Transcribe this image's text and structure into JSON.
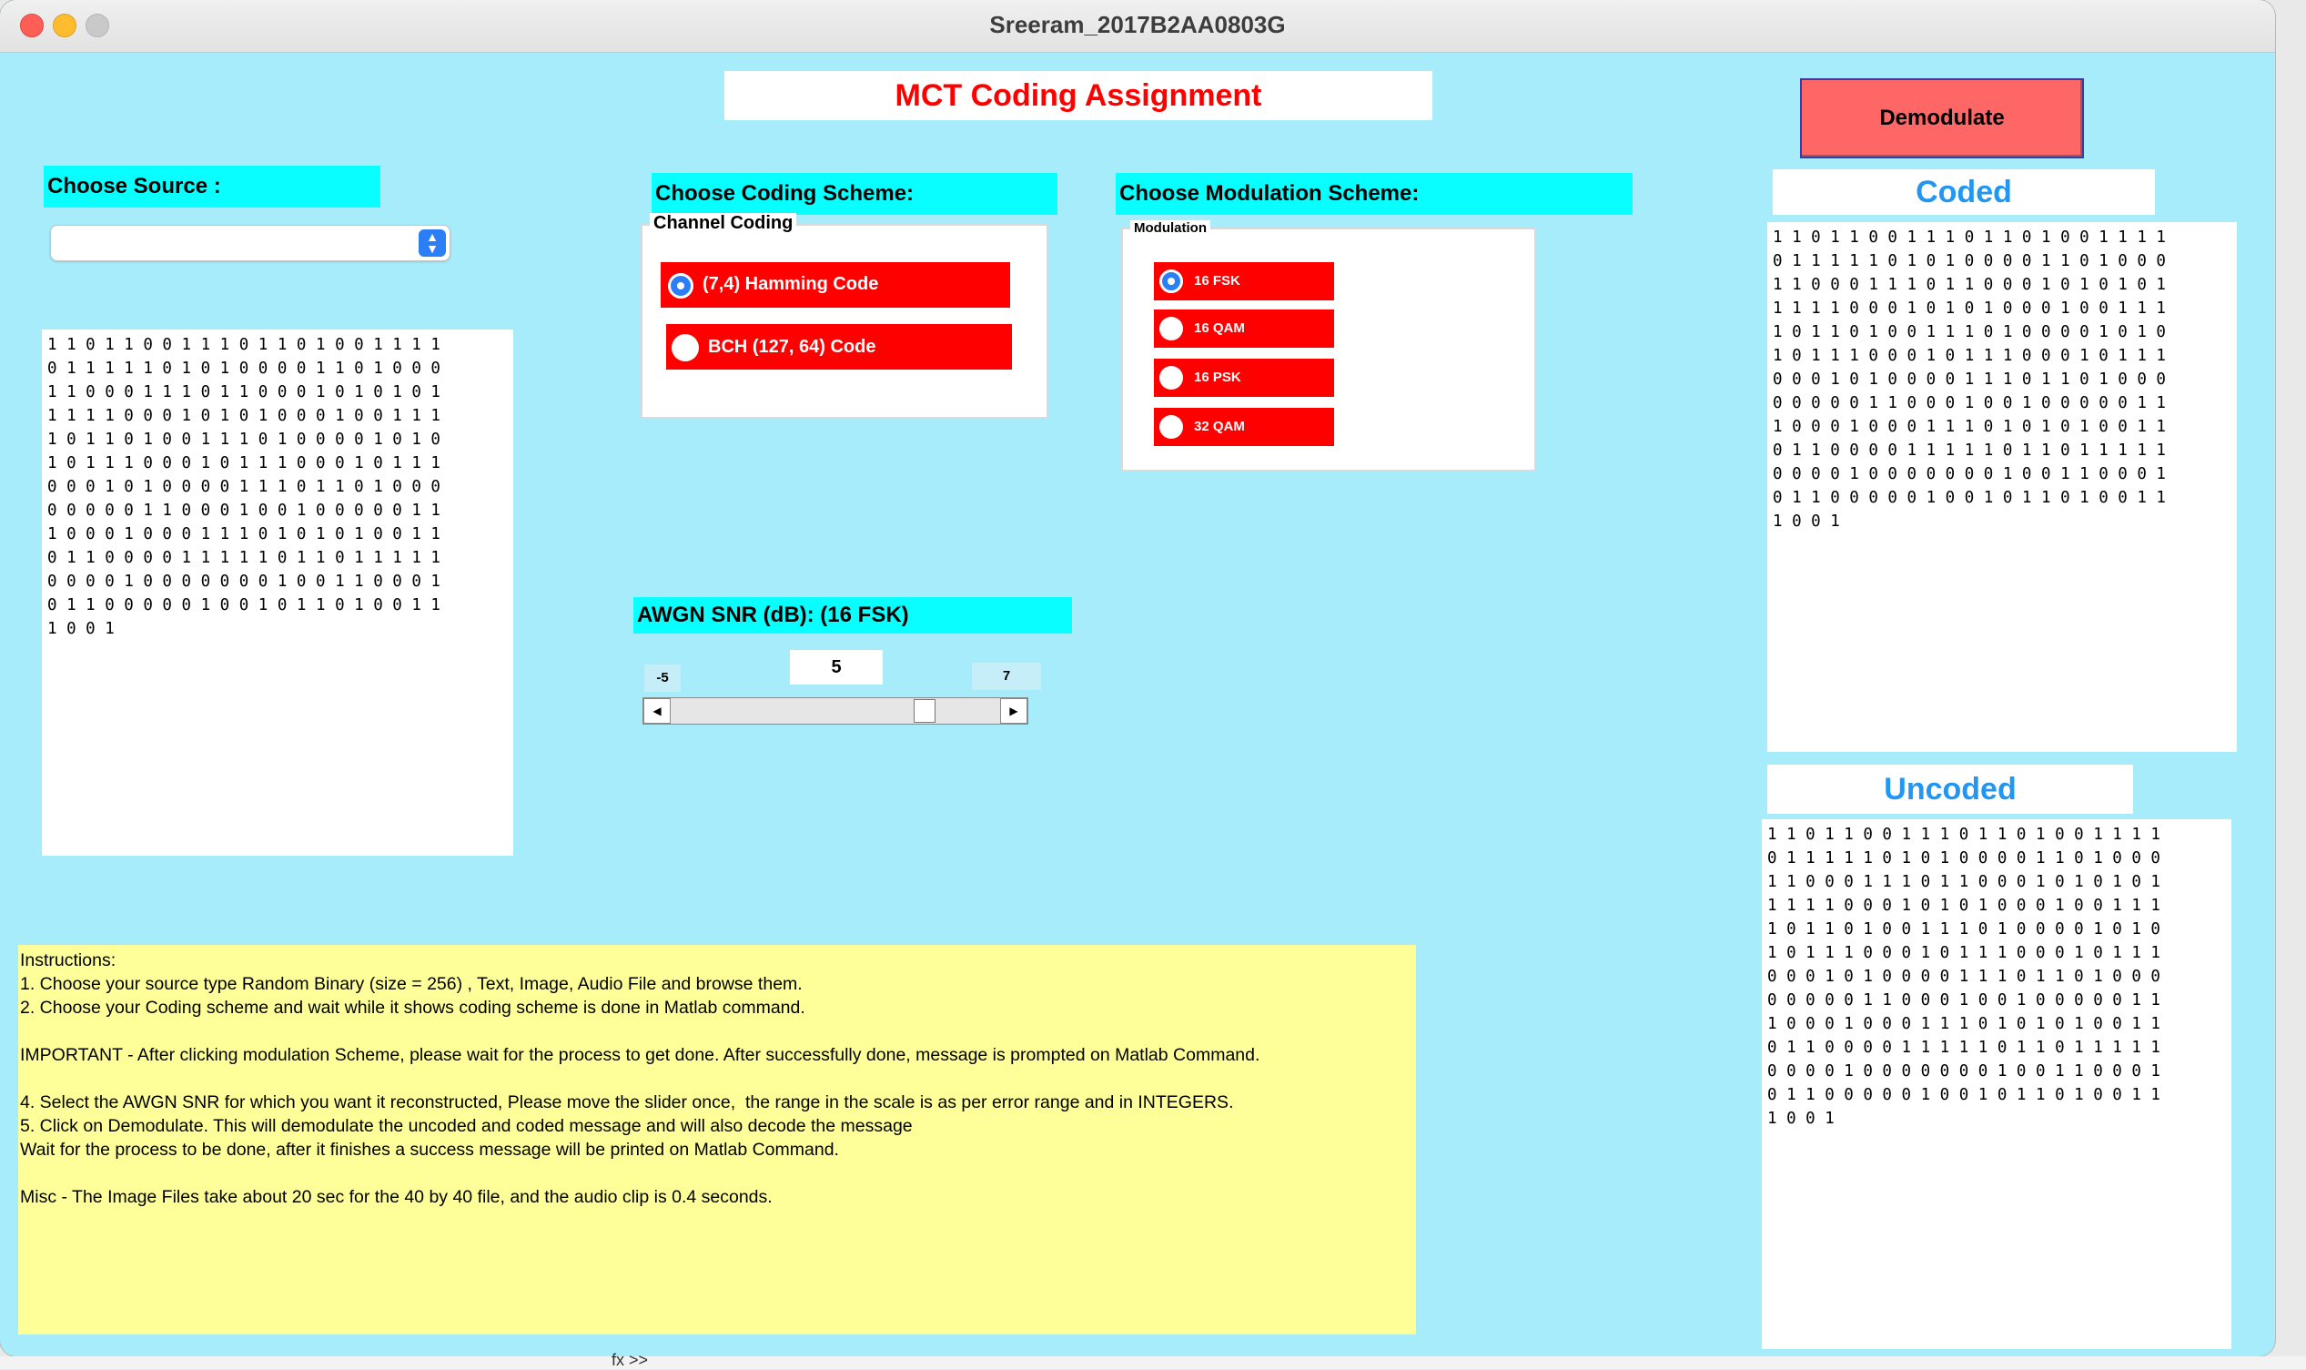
{
  "window": {
    "title": "Sreeram_2017B2AA0803G"
  },
  "header": {
    "title": "MCT Coding Assignment"
  },
  "source": {
    "label": "Choose Source :",
    "selected": "",
    "bits": [
      "1 1 0 1 1 0 0 1 1 1 0 1 1 0 1 0 0 1 1 1 1",
      "0 1 1 1 1 1 0 1 0 1 0 0 0 0 1 1 0 1 0 0 0",
      "1 1 0 0 0 1 1 1 0 1 1 0 0 0 1 0 1 0 1 0 1",
      "1 1 1 1 0 0 0 1 0 1 0 1 0 0 0 1 0 0 1 1 1",
      "1 0 1 1 0 1 0 0 1 1 1 0 1 0 0 0 0 1 0 1 0",
      "1 0 1 1 1 0 0 0 1 0 1 1 1 0 0 0 1 0 1 1 1",
      "0 0 0 1 0 1 0 0 0 0 1 1 1 0 1 1 0 1 0 0 0",
      "0 0 0 0 0 1 1 0 0 0 1 0 0 1 0 0 0 0 0 1 1",
      "1 0 0 0 1 0 0 0 1 1 1 0 1 0 1 0 1 0 0 1 1",
      "0 1 1 0 0 0 0 1 1 1 1 1 0 1 1 0 1 1 1 1 1",
      "0 0 0 0 1 0 0 0 0 0 0 0 1 0 0 1 1 0 0 0 1",
      "0 1 1 0 0 0 0 0 1 0 0 1 0 1 1 0 1 0 0 1 1",
      "1 0 0 1"
    ]
  },
  "coding": {
    "label": "Choose Coding Scheme:",
    "group_title": "Channel Coding",
    "options": [
      "(7,4) Hamming Code",
      "BCH (127, 64) Code"
    ],
    "selected": "(7,4) Hamming Code"
  },
  "modulation": {
    "label": "Choose Modulation Scheme:",
    "group_title": "Modulation",
    "options": [
      "16 FSK",
      "16 QAM",
      "16 PSK",
      "32 QAM"
    ],
    "selected": "16 FSK"
  },
  "snr": {
    "label": "AWGN SNR (dB): (16 FSK)",
    "value": "5",
    "min": "-5",
    "max": "7",
    "fraction": 0.79
  },
  "demodulate_button": "Demodulate",
  "coded": {
    "title": "Coded",
    "bits": [
      "1 1 0 1 1 0 0 1 1 1 0 1 1 0 1 0 0 1 1 1 1",
      "0 1 1 1 1 1 0 1 0 1 0 0 0 0 1 1 0 1 0 0 0",
      "1 1 0 0 0 1 1 1 0 1 1 0 0 0 1 0 1 0 1 0 1",
      "1 1 1 1 0 0 0 1 0 1 0 1 0 0 0 1 0 0 1 1 1",
      "1 0 1 1 0 1 0 0 1 1 1 0 1 0 0 0 0 1 0 1 0",
      "1 0 1 1 1 0 0 0 1 0 1 1 1 0 0 0 1 0 1 1 1",
      "0 0 0 1 0 1 0 0 0 0 1 1 1 0 1 1 0 1 0 0 0",
      "0 0 0 0 0 1 1 0 0 0 1 0 0 1 0 0 0 0 0 1 1",
      "1 0 0 0 1 0 0 0 1 1 1 0 1 0 1 0 1 0 0 1 1",
      "0 1 1 0 0 0 0 1 1 1 1 1 0 1 1 0 1 1 1 1 1",
      "0 0 0 0 1 0 0 0 0 0 0 0 1 0 0 1 1 0 0 0 1",
      "0 1 1 0 0 0 0 0 1 0 0 1 0 1 1 0 1 0 0 1 1",
      "1 0 0 1"
    ]
  },
  "uncoded": {
    "title": "Uncoded",
    "bits": [
      "1 1 0 1 1 0 0 1 1 1 0 1 1 0 1 0 0 1 1 1 1",
      "0 1 1 1 1 1 0 1 0 1 0 0 0 0 1 1 0 1 0 0 0",
      "1 1 0 0 0 1 1 1 0 1 1 0 0 0 1 0 1 0 1 0 1",
      "1 1 1 1 0 0 0 1 0 1 0 1 0 0 0 1 0 0 1 1 1",
      "1 0 1 1 0 1 0 0 1 1 1 0 1 0 0 0 0 1 0 1 0",
      "1 0 1 1 1 0 0 0 1 0 1 1 1 0 0 0 1 0 1 1 1",
      "0 0 0 1 0 1 0 0 0 0 1 1 1 0 1 1 0 1 0 0 0",
      "0 0 0 0 0 1 1 0 0 0 1 0 0 1 0 0 0 0 0 1 1",
      "1 0 0 0 1 0 0 0 1 1 1 0 1 0 1 0 1 0 0 1 1",
      "0 1 1 0 0 0 0 1 1 1 1 1 0 1 1 0 1 1 1 1 1",
      "0 0 0 0 1 0 0 0 0 0 0 0 1 0 0 1 1 0 0 0 1",
      "0 1 1 0 0 0 0 0 1 0 0 1 0 1 1 0 1 0 0 1 1",
      "1 0 0 1"
    ]
  },
  "instructions": [
    "Instructions:",
    "1. Choose your source type Random Binary (size = 256) , Text, Image, Audio File and browse them.",
    "2. Choose your Coding scheme and wait while it shows coding scheme is done in Matlab command.",
    "",
    "IMPORTANT - After clicking modulation Scheme, please wait for the process to get done. After successfully done, message is prompted on Matlab Command.",
    "",
    "4. Select the AWGN SNR for which you want it reconstructed, Please move the slider once,  the range in the scale is as per error range and in INTEGERS.",
    "5. Click on Demodulate. This will demodulate the uncoded and coded message and will also decode the message",
    "Wait for the process to be done, after it finishes a success message will be printed on Matlab Command.",
    "",
    "Misc - The Image Files take about 20 sec for the 40 by 40 file, and the audio clip is 0.4 seconds."
  ],
  "background_prompt": "fx >>",
  "colors": {
    "background": "#a6ecfb",
    "label_cyan": "#09ffff",
    "radio_red": "#ff0000",
    "button_red": "#ff6666",
    "heading_blue": "#2196f3",
    "instructions_yellow": "#ffff9a",
    "title_red": "#ff0000"
  }
}
